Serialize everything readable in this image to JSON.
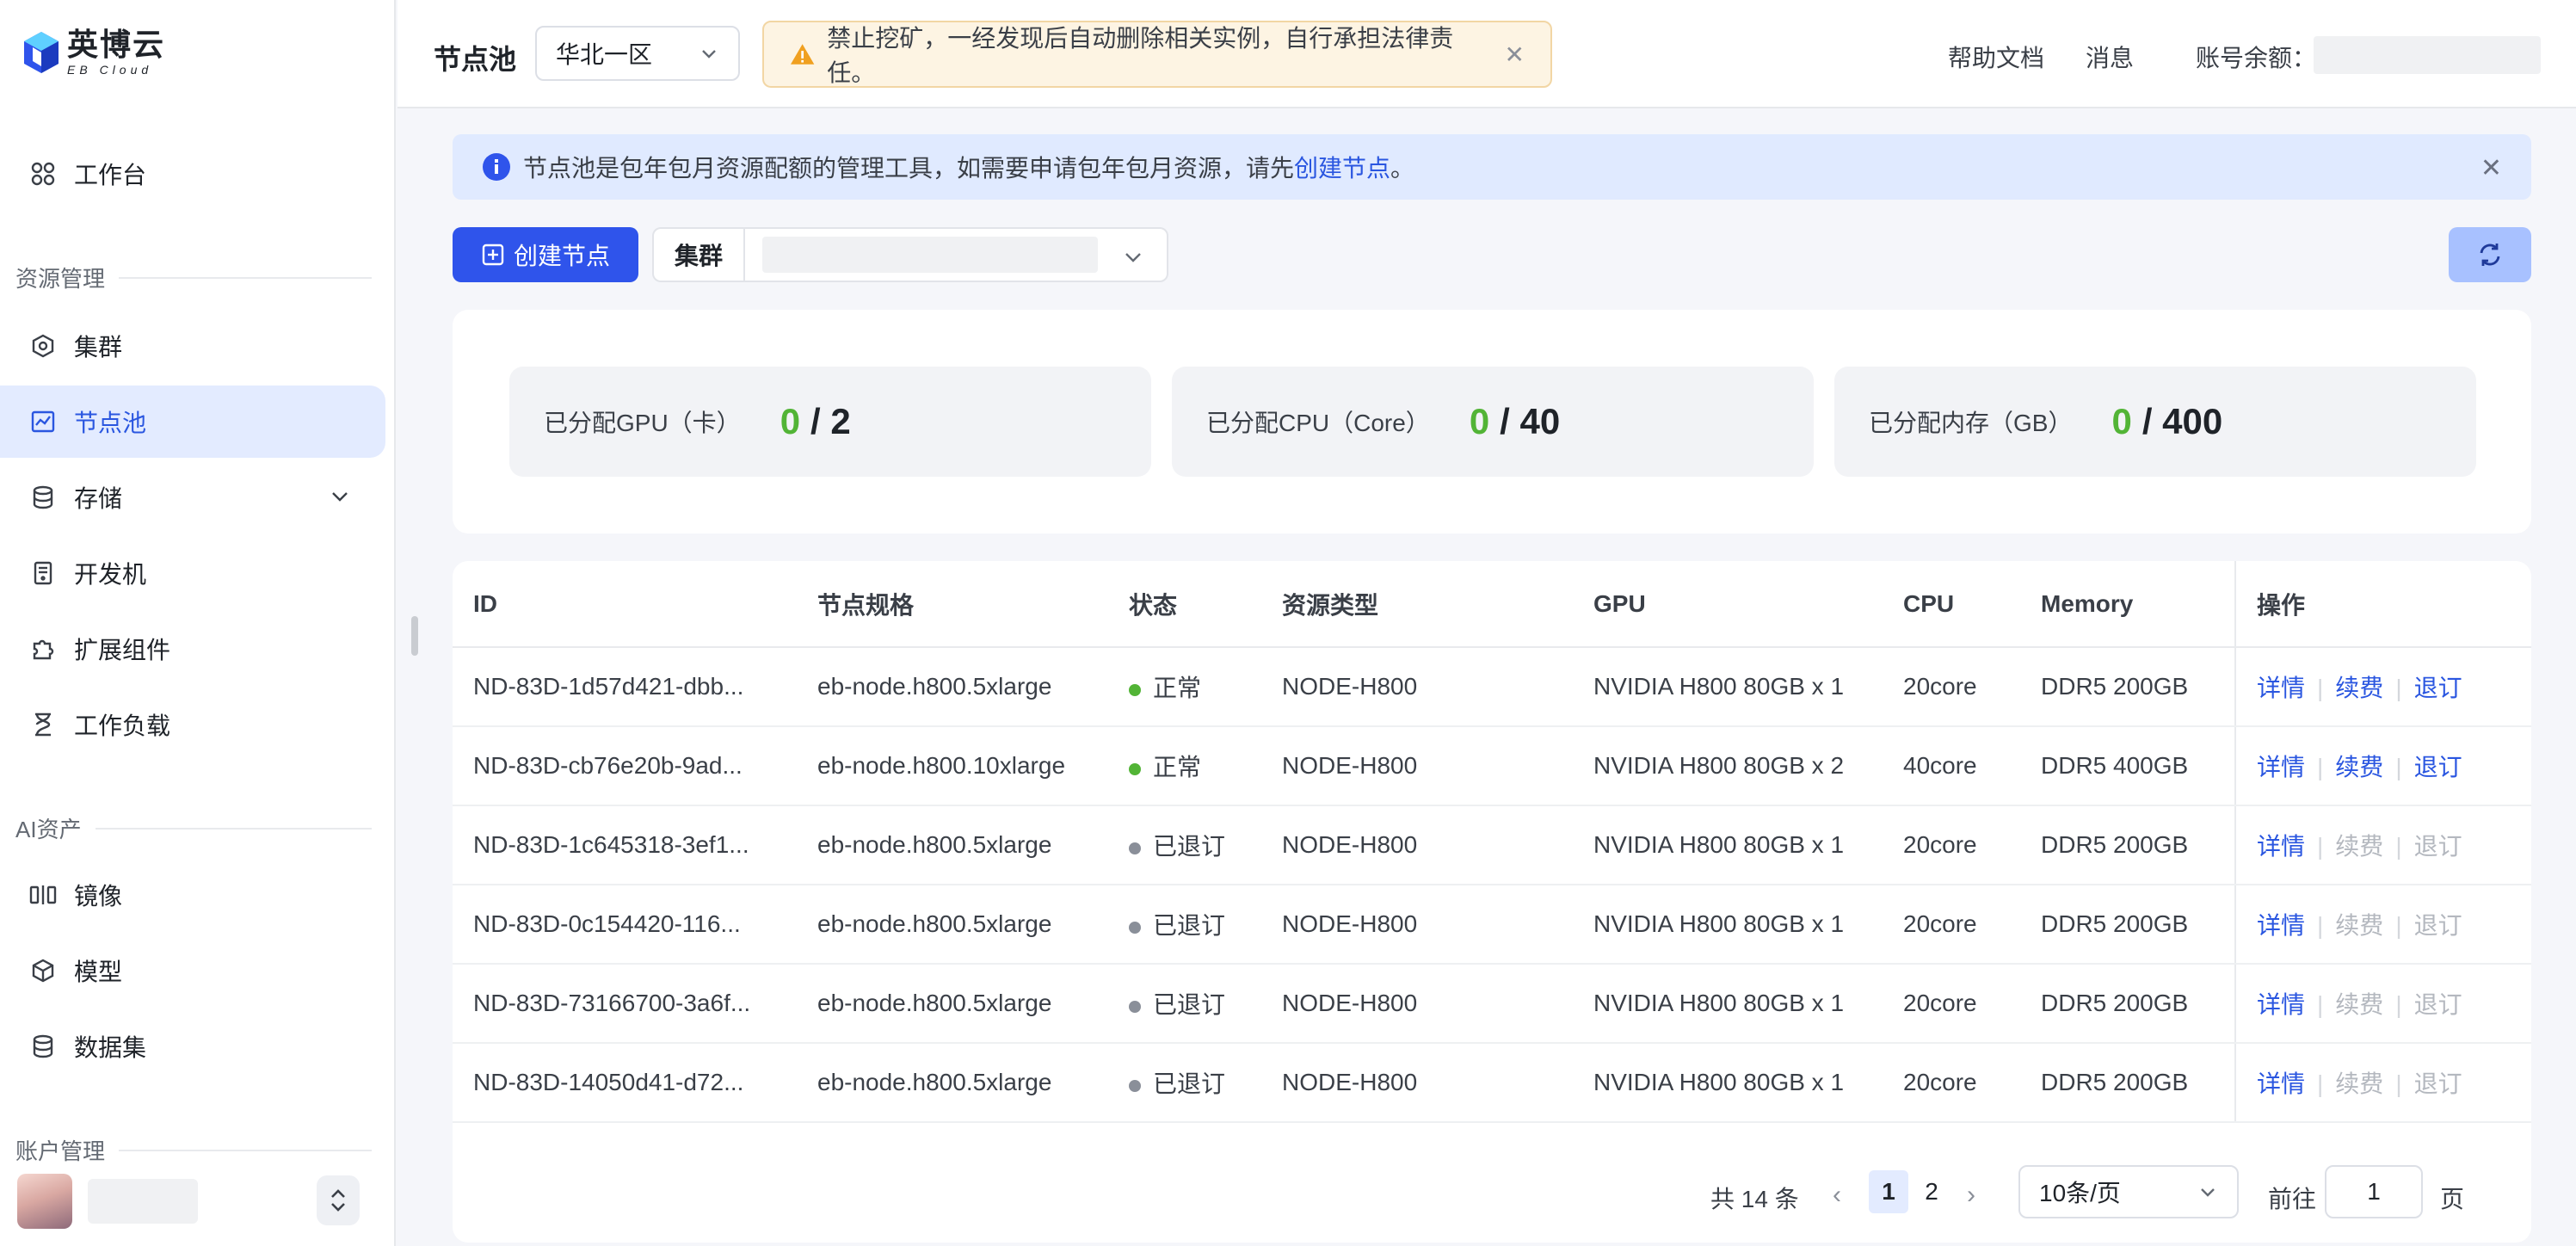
{
  "brand": {
    "name_cn": "英博云",
    "name_en": "EB Cloud"
  },
  "sidebar": {
    "workbench": "工作台",
    "section_resources": "资源管理",
    "items_resources": [
      {
        "label": "集群",
        "icon": "cluster-icon"
      },
      {
        "label": "节点池",
        "icon": "node-pool-icon",
        "active": true
      },
      {
        "label": "存储",
        "icon": "database-icon",
        "has_children": true
      },
      {
        "label": "开发机",
        "icon": "dev-machine-icon"
      },
      {
        "label": "扩展组件",
        "icon": "puzzle-icon"
      },
      {
        "label": "工作负载",
        "icon": "hourglass-icon"
      }
    ],
    "section_ai": "AI资产",
    "items_ai": [
      {
        "label": "镜像",
        "icon": "image-icon"
      },
      {
        "label": "模型",
        "icon": "cube-icon"
      },
      {
        "label": "数据集",
        "icon": "database-icon"
      }
    ],
    "section_account": "账户管理"
  },
  "header": {
    "title": "节点池",
    "region": "华北一区",
    "warning": "禁止挖矿，一经发现后自动删除相关实例，自行承担法律责任。",
    "help": "帮助文档",
    "messages": "消息",
    "balance_label": "账号余额："
  },
  "info_banner": {
    "text_before": "节点池是包年包月资源配额的管理工具，如需要申请包年包月资源，请先",
    "link": "创建节点",
    "text_after": "。"
  },
  "toolbar": {
    "create_label": "创建节点",
    "cluster_label": "集群"
  },
  "stats": [
    {
      "label": "已分配GPU（卡）",
      "used": "0",
      "total": "2"
    },
    {
      "label": "已分配CPU（Core）",
      "used": "0",
      "total": "40"
    },
    {
      "label": "已分配内存（GB）",
      "used": "0",
      "total": "400"
    }
  ],
  "table": {
    "columns": [
      "ID",
      "节点规格",
      "状态",
      "资源类型",
      "GPU",
      "CPU",
      "Memory",
      "操作"
    ],
    "actions": [
      "详情",
      "续费",
      "退订"
    ],
    "rows": [
      {
        "id": "ND-83D-1d57d421-dbb...",
        "spec": "eb-node.h800.5xlarge",
        "status": "正常",
        "type": "NODE-H800",
        "gpu": "NVIDIA H800 80GB x 1",
        "cpu": "20core",
        "mem": "DDR5 200GB",
        "active": true
      },
      {
        "id": "ND-83D-cb76e20b-9ad...",
        "spec": "eb-node.h800.10xlarge",
        "status": "正常",
        "type": "NODE-H800",
        "gpu": "NVIDIA H800 80GB x 2",
        "cpu": "40core",
        "mem": "DDR5 400GB",
        "active": true
      },
      {
        "id": "ND-83D-1c645318-3ef1...",
        "spec": "eb-node.h800.5xlarge",
        "status": "已退订",
        "type": "NODE-H800",
        "gpu": "NVIDIA H800 80GB x 1",
        "cpu": "20core",
        "mem": "DDR5 200GB",
        "active": false
      },
      {
        "id": "ND-83D-0c154420-116...",
        "spec": "eb-node.h800.5xlarge",
        "status": "已退订",
        "type": "NODE-H800",
        "gpu": "NVIDIA H800 80GB x 1",
        "cpu": "20core",
        "mem": "DDR5 200GB",
        "active": false
      },
      {
        "id": "ND-83D-73166700-3a6f...",
        "spec": "eb-node.h800.5xlarge",
        "status": "已退订",
        "type": "NODE-H800",
        "gpu": "NVIDIA H800 80GB x 1",
        "cpu": "20core",
        "mem": "DDR5 200GB",
        "active": false
      },
      {
        "id": "ND-83D-14050d41-d72...",
        "spec": "eb-node.h800.5xlarge",
        "status": "已退订",
        "type": "NODE-H800",
        "gpu": "NVIDIA H800 80GB x 1",
        "cpu": "20core",
        "mem": "DDR5 200GB",
        "active": false
      }
    ]
  },
  "pagination": {
    "total": "共 14 条",
    "pages": [
      "1",
      "2"
    ],
    "current": "1",
    "page_size": "10条/页",
    "goto_label": "前往",
    "goto_value": "1",
    "goto_unit": "页"
  },
  "colors": {
    "primary": "#2f54eb",
    "active_bg": "#e3ebff",
    "success": "#52b436",
    "disabled": "#b4b8bf",
    "warning_bg": "#fdf4e3"
  }
}
